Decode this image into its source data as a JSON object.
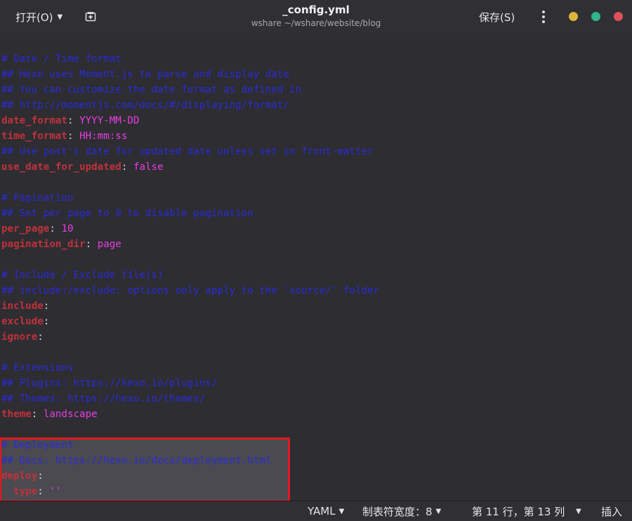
{
  "header": {
    "open_label": "打开(O)",
    "title": "_config.yml",
    "subtitle": "wshare ~/wshare/website/blog",
    "save_label": "保存(S)",
    "window_colors": {
      "minimize": "#e0b43a",
      "maximize": "#2fb68a",
      "close": "#e0505a"
    }
  },
  "editor": {
    "lines": [
      {
        "t": "comment",
        "text": "# Date / Time format"
      },
      {
        "t": "comment",
        "text": "## Hexo uses Moment.js to parse and display date"
      },
      {
        "t": "comment",
        "text": "## You can customize the date format as defined in"
      },
      {
        "t": "comment",
        "text": "## http://momentjs.com/docs/#/displaying/format/"
      },
      {
        "t": "kv",
        "key": "date_format",
        "value": "YYYY-MM-DD"
      },
      {
        "t": "kv",
        "key": "time_format",
        "value": "HH:mm:ss"
      },
      {
        "t": "comment",
        "text": "## Use post's date for updated date unless set in front-matter"
      },
      {
        "t": "kv",
        "key": "use_date_for_updated",
        "value": "false"
      },
      {
        "t": "blank"
      },
      {
        "t": "comment",
        "text": "# Pagination"
      },
      {
        "t": "comment",
        "text": "## Set per_page to 0 to disable pagination"
      },
      {
        "t": "kv",
        "key": "per_page",
        "value": "10"
      },
      {
        "t": "kv",
        "key": "pagination_dir",
        "value": "page"
      },
      {
        "t": "blank"
      },
      {
        "t": "comment",
        "text": "# Include / Exclude file(s)"
      },
      {
        "t": "comment",
        "text": "## include:/exclude: options only apply to the 'source/' folder"
      },
      {
        "t": "kv",
        "key": "include",
        "value": ""
      },
      {
        "t": "kv",
        "key": "exclude",
        "value": ""
      },
      {
        "t": "kv",
        "key": "ignore",
        "value": ""
      },
      {
        "t": "blank"
      },
      {
        "t": "comment",
        "text": "# Extensions"
      },
      {
        "t": "comment",
        "text": "## Plugins: https://hexo.io/plugins/"
      },
      {
        "t": "comment",
        "text": "## Themes: https://hexo.io/themes/"
      },
      {
        "t": "kv",
        "key": "theme",
        "value": "landscape"
      },
      {
        "t": "blank"
      },
      {
        "t": "comment",
        "text": "# Deployment"
      },
      {
        "t": "comment",
        "text": "## Docs: https://hexo.io/docs/deployment.html"
      },
      {
        "t": "kv",
        "key": "deploy",
        "value": ""
      },
      {
        "t": "kv",
        "indent": "  ",
        "key": "type",
        "value": "''"
      }
    ]
  },
  "status": {
    "language": "YAML",
    "tab_width": "制表符宽度：8",
    "position": "第 11 行，第 13 列",
    "mode": "插入"
  }
}
